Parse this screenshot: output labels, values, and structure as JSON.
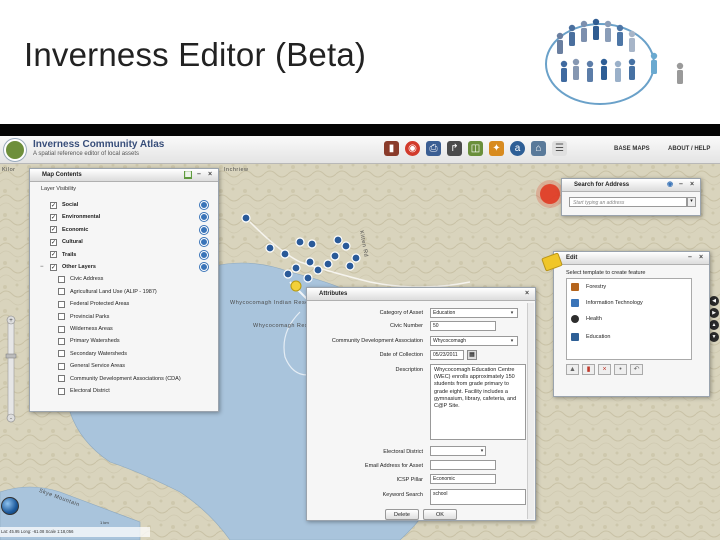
{
  "slide": {
    "title": "Inverness Editor (Beta)"
  },
  "app": {
    "title": "Inverness Community Atlas",
    "subtitle": "A spatial reference editor of local assets",
    "header_links": {
      "base_maps": "BASE MAPS",
      "about_help": "ABOUT / HELP"
    },
    "toolbar_icons": [
      "bookmark-icon",
      "target-icon",
      "printer-icon",
      "measure-icon",
      "basemap-icon",
      "identify-icon",
      "search-icon",
      "home-icon",
      "list-icon"
    ]
  },
  "map": {
    "labels": {
      "place_top": "Inchriew",
      "reserve_1": "Whycocomagh Indian Reserve 2",
      "reserve_2": "Whycocomagh Reserve",
      "road": "Kitten Rd",
      "river": "Skye Mountain",
      "left_top": "Kilor"
    }
  },
  "map_contents": {
    "title": "Map Contents",
    "group_label": "Layer Visibility",
    "layers": [
      {
        "label": "Social",
        "checked": true,
        "bold": true,
        "has_icon": true
      },
      {
        "label": "Environmental",
        "checked": true,
        "bold": true,
        "has_icon": true
      },
      {
        "label": "Economic",
        "checked": true,
        "bold": true,
        "has_icon": true
      },
      {
        "label": "Cultural",
        "checked": true,
        "bold": true,
        "has_icon": true
      },
      {
        "label": "Trails",
        "checked": true,
        "bold": true,
        "has_icon": true
      },
      {
        "label": "Other Layers",
        "checked": true,
        "bold": true,
        "has_icon": true
      },
      {
        "label": "Civic Address",
        "checked": false,
        "bold": false,
        "has_icon": false
      },
      {
        "label": "Agricultural Land Use (ALIP - 1987)",
        "checked": false,
        "bold": false,
        "has_icon": false
      },
      {
        "label": "Federal Protected Areas",
        "checked": false,
        "bold": false,
        "has_icon": false
      },
      {
        "label": "Provincial Parks",
        "checked": false,
        "bold": false,
        "has_icon": false
      },
      {
        "label": "Wilderness Areas",
        "checked": false,
        "bold": false,
        "has_icon": false
      },
      {
        "label": "Primary Watersheds",
        "checked": false,
        "bold": false,
        "has_icon": false
      },
      {
        "label": "Secondary Watersheds",
        "checked": false,
        "bold": false,
        "has_icon": false
      },
      {
        "label": "General Service Areas",
        "checked": false,
        "bold": false,
        "has_icon": false
      },
      {
        "label": "Community Development Associations (CDA)",
        "checked": false,
        "bold": false,
        "has_icon": false
      },
      {
        "label": "Electoral District",
        "checked": false,
        "bold": false,
        "has_icon": false
      }
    ]
  },
  "search": {
    "title": "Search for Address",
    "placeholder": "Start typing an address"
  },
  "edit": {
    "title": "Edit",
    "note": "Select template to create feature",
    "templates": [
      {
        "label": "Forestry",
        "icon": "tree-icon"
      },
      {
        "label": "Information Technology",
        "icon": "computer-icon"
      },
      {
        "label": "Health",
        "icon": "health-icon"
      },
      {
        "label": "Education",
        "icon": "education-icon"
      }
    ]
  },
  "attributes": {
    "title": "Attributes",
    "fields": {
      "category_label": "Category of Asset",
      "category_value": "Education",
      "civic_label": "Civic Number",
      "civic_value": "50",
      "cda_label": "Community Development Association",
      "cda_value": "Whycocomagh",
      "date_label": "Date of Collection",
      "date_value": "05/23/2011",
      "desc_label": "Description",
      "desc_value": "Whycocomagh Education Centre (WEC) enrolls approximately 150 students from grade primary to grade eight. Facility includes a gymnasium, library, cafeteria, and C@P Site.",
      "electoral_label": "Electoral District",
      "electoral_value": "",
      "email_label": "Email Address for Asset",
      "email_value": "",
      "icsp_label": "ICSP Pillar",
      "icsp_value": "Economic",
      "keyword_label": "Keyword Search",
      "keyword_value": "school"
    },
    "delete_label": "Delete",
    "ok_label": "OK"
  },
  "footer": {
    "coords": "Lat: 45.95  Long: -61.08    Scale 1:18,056",
    "scale_bar": "1 km"
  },
  "colors": {
    "water": "#a8c6e0",
    "land": "#d8d3bd",
    "app_header_title": "#384e7a"
  }
}
